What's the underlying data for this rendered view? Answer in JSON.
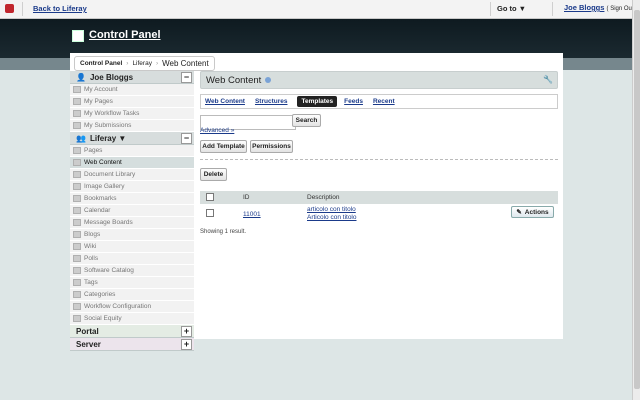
{
  "topbar": {
    "back_label": "Back to Liferay",
    "goto_label": "Go to ▼",
    "user_name": "Joe Bloggs",
    "signout_label": "( Sign Out )"
  },
  "header": {
    "title": "Control Panel"
  },
  "breadcrumb": [
    "Control Panel",
    "Liferay",
    "Web Content"
  ],
  "sidebar": {
    "user_section": {
      "title": "Joe Bloggs",
      "items": [
        "My Account",
        "My Pages",
        "My Workflow Tasks",
        "My Submissions"
      ]
    },
    "liferay_section": {
      "title": "Liferay ▼",
      "items": [
        "Pages",
        "Web Content",
        "Document Library",
        "Image Gallery",
        "Bookmarks",
        "Calendar",
        "Message Boards",
        "Blogs",
        "Wiki",
        "Polls",
        "Software Catalog",
        "Tags",
        "Categories",
        "Workflow Configuration",
        "Social Equity"
      ],
      "active_item": "Web Content"
    },
    "portal_title": "Portal",
    "server_title": "Server"
  },
  "main": {
    "title": "Web Content",
    "tabs": [
      "Web Content",
      "Structures",
      "Templates",
      "Feeds",
      "Recent"
    ],
    "selected_tab": "Templates",
    "search_input_value": "",
    "search_button": "Search",
    "advanced_link": "Advanced »",
    "add_template_button": "Add Template",
    "permissions_button": "Permissions",
    "delete_button": "Delete",
    "table": {
      "headers": [
        "",
        "ID",
        "Description"
      ],
      "rows": [
        {
          "id": "11001",
          "description": [
            "articolo con titolo",
            "Articolo con titolo"
          ],
          "actions": "Actions"
        }
      ]
    },
    "status": "Showing 1 result."
  },
  "colors": {
    "header_bg": "#0e1a20",
    "accent": "#1a3a8a",
    "panel_head": "#d7dedd"
  }
}
